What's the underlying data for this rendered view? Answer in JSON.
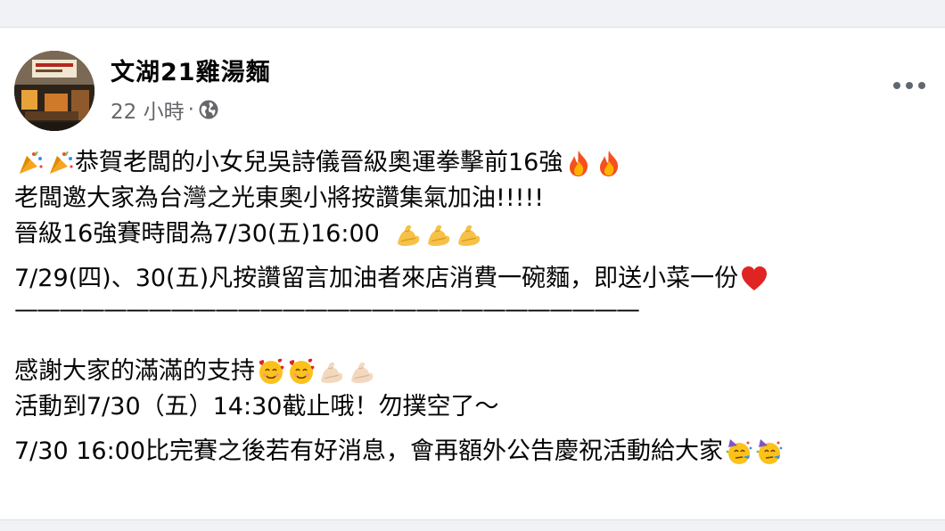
{
  "post": {
    "page_name": "文湖21雞湯麵",
    "time": "22 小時",
    "dot": "·",
    "lines": [
      "恭賀老闆的小女兒吳詩儀晉級奧運拳擊前16強",
      "老闆邀大家為台灣之光東奧小將按讚集氣加油!!!!!",
      "晉級16強賽時間為7/30(五)16:00",
      "7/29(四)、30(五)凡按讚留言加油者來店消費一碗麵，即送小菜一份",
      "————————————————————————————",
      "感謝大家的滿滿的支持",
      "活動到7/30（五）14:30截止哦！勿撲空了～",
      "7/30 16:00比完賽之後若有好消息，會再額外公告慶祝活動給大家"
    ]
  },
  "icons": {
    "globe": "globe-icon",
    "more": "more-options-icon",
    "party": "party-popper-emoji",
    "fire": "fire-emoji",
    "muscle": "flexed-biceps-emoji",
    "heart": "red-heart-emoji",
    "hearts_face": "smiling-face-with-hearts-emoji",
    "party_face": "partying-face-emoji"
  },
  "colors": {
    "text_primary": "#050505",
    "text_secondary": "#65676b",
    "background": "#f0f2f5",
    "card": "#ffffff"
  }
}
